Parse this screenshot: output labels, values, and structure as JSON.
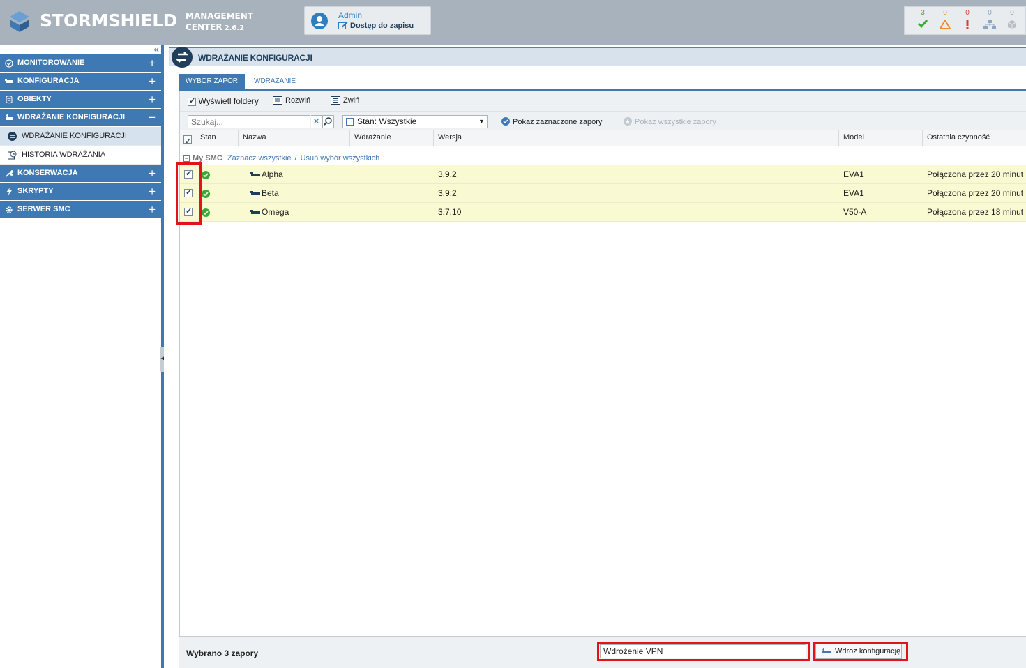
{
  "header": {
    "brand": "STORMSHIELD",
    "product_line1": "MANAGEMENT",
    "product_line2": "CENTER",
    "version": "2.6.2",
    "user_name": "Admin",
    "user_mode": "Dostęp do zapisu",
    "status_counts": {
      "ok": "3",
      "warning": "0",
      "error": "0",
      "pending": "0",
      "offline": "0"
    }
  },
  "sidebar": {
    "items": [
      {
        "label": "MONITOROWANIE",
        "icon": "check-circle-icon",
        "expander": "+"
      },
      {
        "label": "KONFIGURACJA",
        "icon": "firewall-icon",
        "expander": "+"
      },
      {
        "label": "OBIEKTY",
        "icon": "database-icon",
        "expander": "+"
      },
      {
        "label": "WDRAŻANIE KONFIGURACJI",
        "icon": "deploy-icon",
        "expander": "−"
      },
      {
        "label": "KONSERWACJA",
        "icon": "wrench-icon",
        "expander": "+"
      },
      {
        "label": "SKRYPTY",
        "icon": "lightning-icon",
        "expander": "+"
      },
      {
        "label": "SERWER SMC",
        "icon": "gear-icon",
        "expander": "+"
      }
    ],
    "sub_items": [
      {
        "label": "WDRAŻANIE KONFIGURACJI",
        "icon": "deploy-icon"
      },
      {
        "label": "HISTORIA WDRAŻANIA",
        "icon": "history-icon"
      }
    ]
  },
  "main": {
    "title": "WDRAŻANIE KONFIGURACJI",
    "tabs": [
      {
        "label": "WYBÓR ZAPÓR"
      },
      {
        "label": "WDRAŻANIE"
      }
    ],
    "toolbar": {
      "show_folders": "Wyświetl foldery",
      "expand": "Rozwiń",
      "collapse": "Zwiń",
      "search_placeholder": "Szukaj...",
      "state_filter": "Stan: Wszystkie",
      "show_selected": "Pokaż zaznaczone zapory",
      "show_all": "Pokaż wszystkie zapory"
    },
    "columns": [
      "Stan",
      "Nazwa",
      "Wdrażanie",
      "Wersja",
      "Model",
      "Ostatnia czynność"
    ],
    "group": {
      "name": "My SMC",
      "select_all": "Zaznacz wszystkie",
      "separator": "/",
      "deselect_all": "Usuń wybór wszystkich"
    },
    "rows": [
      {
        "name": "Alpha",
        "deploy": "",
        "version": "3.9.2",
        "model": "EVA1",
        "last_activity": "Połączona przez 20 minut"
      },
      {
        "name": "Beta",
        "deploy": "",
        "version": "3.9.2",
        "model": "EVA1",
        "last_activity": "Połączona przez 20 minut"
      },
      {
        "name": "Omega",
        "deploy": "",
        "version": "3.7.10",
        "model": "V50-A",
        "last_activity": "Połączona przez 18 minut"
      }
    ],
    "footer": {
      "selected_text": "Wybrano 3 zapory",
      "deploy_comment": "Wdrożenie VPN",
      "deploy_button": "Wdroż konfigurację"
    }
  },
  "colors": {
    "accent": "#3e79b3",
    "header_bg": "#a7b2bc",
    "row_highlight": "#fafad2",
    "annotation_red": "#e1141b",
    "ok_green": "#3aaa35",
    "warning_orange": "#f08a24",
    "error_red": "#e03a2f"
  }
}
